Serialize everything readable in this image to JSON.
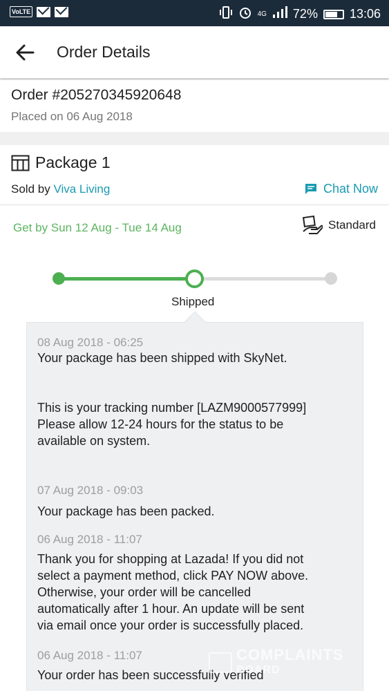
{
  "status_bar": {
    "volte": "VoLTE",
    "network": "4G",
    "battery": "72%",
    "battery_level": 0.72,
    "time": "13:06"
  },
  "app_bar": {
    "title": "Order Details",
    "back_icon": "arrow-left-icon"
  },
  "order": {
    "number": "Order #205270345920648",
    "placed": "Placed on 06 Aug 2018"
  },
  "package": {
    "title": "Package 1",
    "sold_by_label": "Sold by ",
    "seller": "Viva Living",
    "chat": "Chat Now",
    "eta": "Get by Sun 12 Aug - Tue 14 Aug",
    "shipping_type": "Standard",
    "progress": {
      "steps": 3,
      "current_step": 2,
      "current_label": "Shipped"
    }
  },
  "events": [
    {
      "time": "08 Aug 2018 - 06:25",
      "message": "Your package has been shipped with SkyNet.\n\n\nThis is your tracking number [LAZM9000577999]\nPlease allow 12-24 hours for the status to be\navailable on system."
    },
    {
      "time": "07 Aug 2018 - 09:03",
      "message": "Your package has been packed."
    },
    {
      "time": "06 Aug 2018 - 11:07",
      "message": "Thank you for shopping at Lazada! If you did not\nselect a payment method, click PAY NOW above.\nOtherwise, your order will be cancelled\nautomatically after 1 hour. An update will be sent\nvia email once your order is successfully placed."
    },
    {
      "time": "06 Aug 2018 - 11:07",
      "message": "Your order has been successfully verified"
    }
  ],
  "watermark": {
    "line1": "COMPLAINTS",
    "line2": "BOARD"
  },
  "colors": {
    "status_bar": "#1c2b3a",
    "accent_green": "#4caf50",
    "eta_green": "#5bb55f",
    "link_teal": "#1a9ab0",
    "panel_bg": "#eff0f2"
  }
}
